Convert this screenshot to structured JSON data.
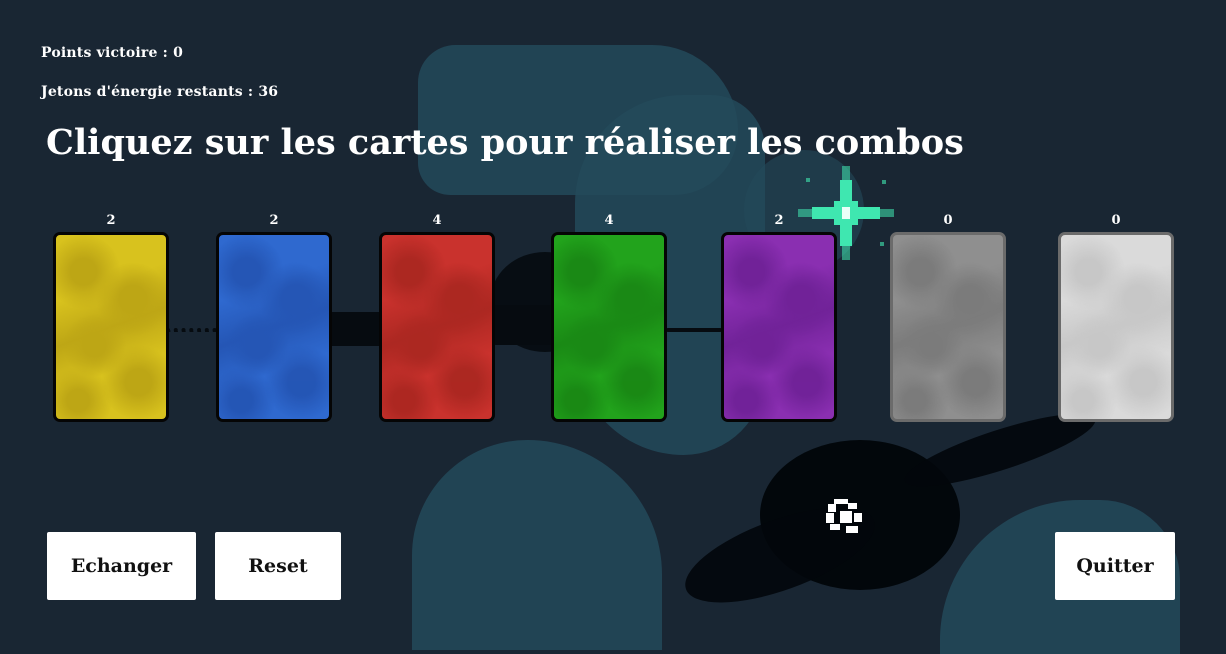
{
  "hud": {
    "points": "Points victoire : 0",
    "jetons": "Jetons d'énergie restants : 36"
  },
  "instruction": "Cliquez sur les cartes pour réaliser les combos",
  "cards": [
    {
      "name": "yellow",
      "count": "2",
      "color": "#d8c21e",
      "shade": "#a8900f",
      "border": "#050505"
    },
    {
      "name": "blue",
      "count": "2",
      "color": "#2f69cf",
      "shade": "#1d47a0",
      "border": "#050505"
    },
    {
      "name": "red",
      "count": "4",
      "color": "#c9322d",
      "shade": "#952019",
      "border": "#050505"
    },
    {
      "name": "green",
      "count": "4",
      "color": "#22a31c",
      "shade": "#147510",
      "border": "#050505"
    },
    {
      "name": "purple",
      "count": "2",
      "color": "#8a2fb1",
      "shade": "#5d1985",
      "border": "#050505"
    },
    {
      "name": "gray",
      "count": "0",
      "color": "#8f8f8f",
      "shade": "#6c6c6c",
      "border": "#6b6b6b"
    },
    {
      "name": "white",
      "count": "0",
      "color": "#dadada",
      "shade": "#b9b9b9",
      "border": "#6b6b6b"
    }
  ],
  "buttons": {
    "echanger": "Echanger",
    "reset": "Reset",
    "quitter": "Quitter"
  },
  "colors": {
    "background": "#192633",
    "sparkle": "#3fe7b0"
  },
  "icons": {
    "sparkle": "sparkle-icon",
    "cursor": "pixel-cursor-icon"
  }
}
